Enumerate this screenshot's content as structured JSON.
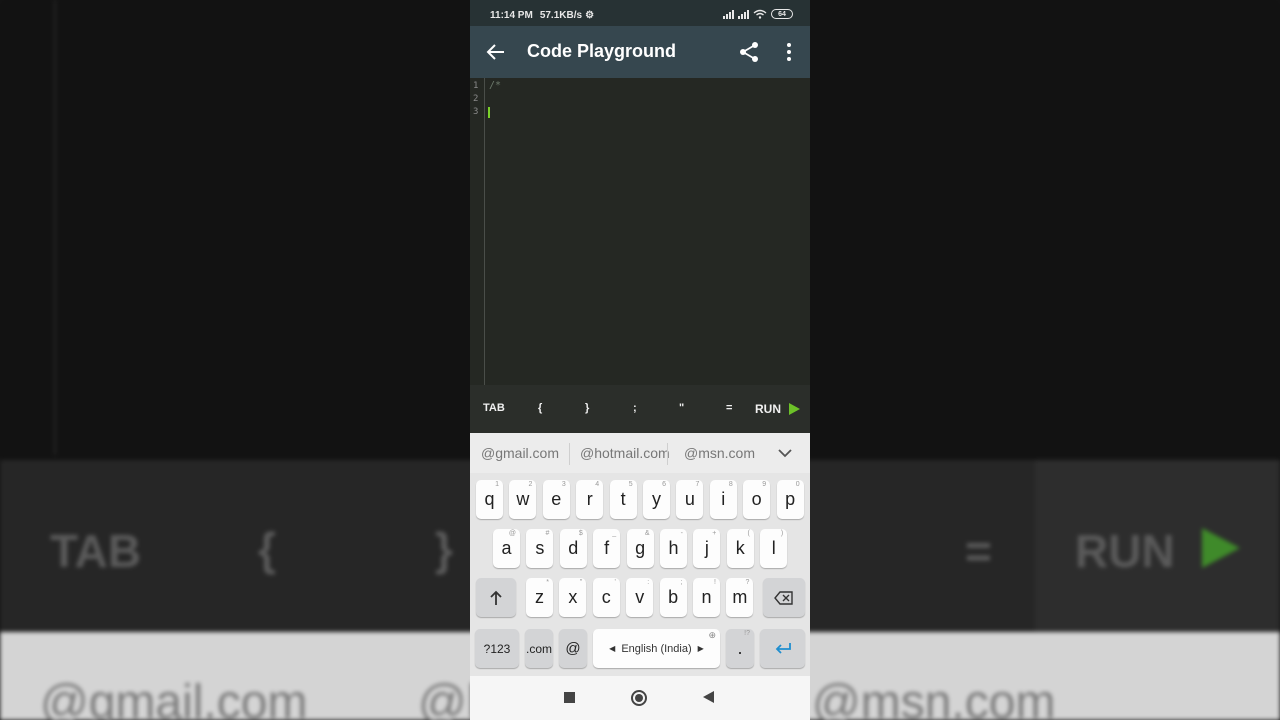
{
  "status": {
    "time": "11:14 PM",
    "speed": "57.1KB/s",
    "battery": "64"
  },
  "app_bar": {
    "title": "Code Playground"
  },
  "editor": {
    "line_numbers": [
      "1",
      "2",
      "3"
    ],
    "code": "/*"
  },
  "symbol_bar": {
    "tab": "TAB",
    "open_brace": "{",
    "close_brace": "}",
    "semicolon": ";",
    "quote": "\"",
    "equals": "=",
    "run": "RUN"
  },
  "keyboard": {
    "suggestions": [
      "@gmail.com",
      "@hotmail.com",
      "@msn.com"
    ],
    "row1": [
      "q",
      "w",
      "e",
      "r",
      "t",
      "y",
      "u",
      "i",
      "o",
      "p"
    ],
    "row1_hints": [
      "1",
      "2",
      "3",
      "4",
      "5",
      "6",
      "7",
      "8",
      "9",
      "0"
    ],
    "row2": [
      "a",
      "s",
      "d",
      "f",
      "g",
      "h",
      "j",
      "k",
      "l"
    ],
    "row2_hints": [
      "@",
      "#",
      "$",
      "_",
      "&",
      "-",
      "+",
      "(",
      ")"
    ],
    "row3": [
      "z",
      "x",
      "c",
      "v",
      "b",
      "n",
      "m"
    ],
    "row3_hints": [
      "*",
      "\"",
      "'",
      ":",
      ";",
      "!",
      "?"
    ],
    "numbers_key": "?123",
    "com_key": ".com",
    "at_key": "@",
    "space_label": "English (India)",
    "period_key": ".",
    "period_hint": "!?"
  },
  "background": {
    "tab": "TAB",
    "open_brace": "{",
    "close_brace": "}",
    "equals": "=",
    "run": "RUN",
    "sug1": "@gmail.com",
    "sug2": "@h",
    "sug3": "@msn.com"
  }
}
